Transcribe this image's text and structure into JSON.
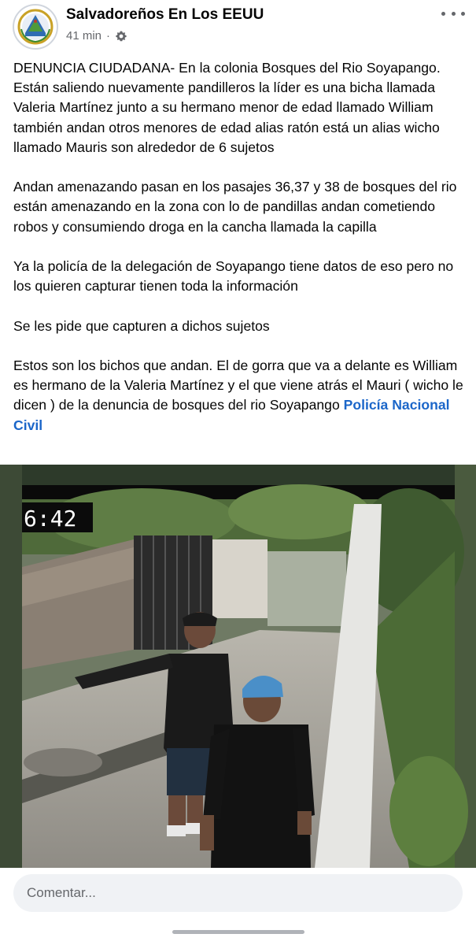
{
  "post": {
    "page_name": "Salvadoreños En Los EEUU",
    "time": "41 min",
    "separator": "·",
    "privacy_icon": "gear-icon",
    "more_icon": "ellipsis-horizontal-icon",
    "avatar_icon": "el-salvador-coat-of-arms-icon",
    "paragraphs": [
      "DENUNCIA CIUDADANA- En la colonia Bosques del Rio Soyapango. Están saliendo nuevamente pandilleros la líder es una bicha llamada Valeria Martínez junto a su hermano menor de edad llamado William también andan otros menores de edad alias ratón está un alias wicho llamado Mauris son alrededor de 6 sujetos",
      "Andan amenazando pasan en los pasajes 36,37 y 38 de bosques del rio están amenazando en la zona con lo de pandillas andan cometiendo robos y consumiendo droga en la cancha llamada la capilla",
      "Ya la policía de la delegación de Soyapango tiene datos de eso pero no los quieren capturar tienen toda la información",
      "Se les pide que capturen a dichos sujetos"
    ],
    "last_paragraph": "Estos son los bichos que andan. El de gorra que va a delante es William es hermano de la Valeria Martínez y el que viene atrás el Mauri ( wicho le dicen ) de la denuncia de bosques del rio Soyapango",
    "mention": "Policía Nacional Civil"
  },
  "photo": {
    "timestamp": "6:42"
  },
  "comment": {
    "placeholder": "Comentar..."
  },
  "colors": {
    "mention": "#1b66c9",
    "secondary_text": "#65676b",
    "comment_bg": "#f0f2f5"
  }
}
